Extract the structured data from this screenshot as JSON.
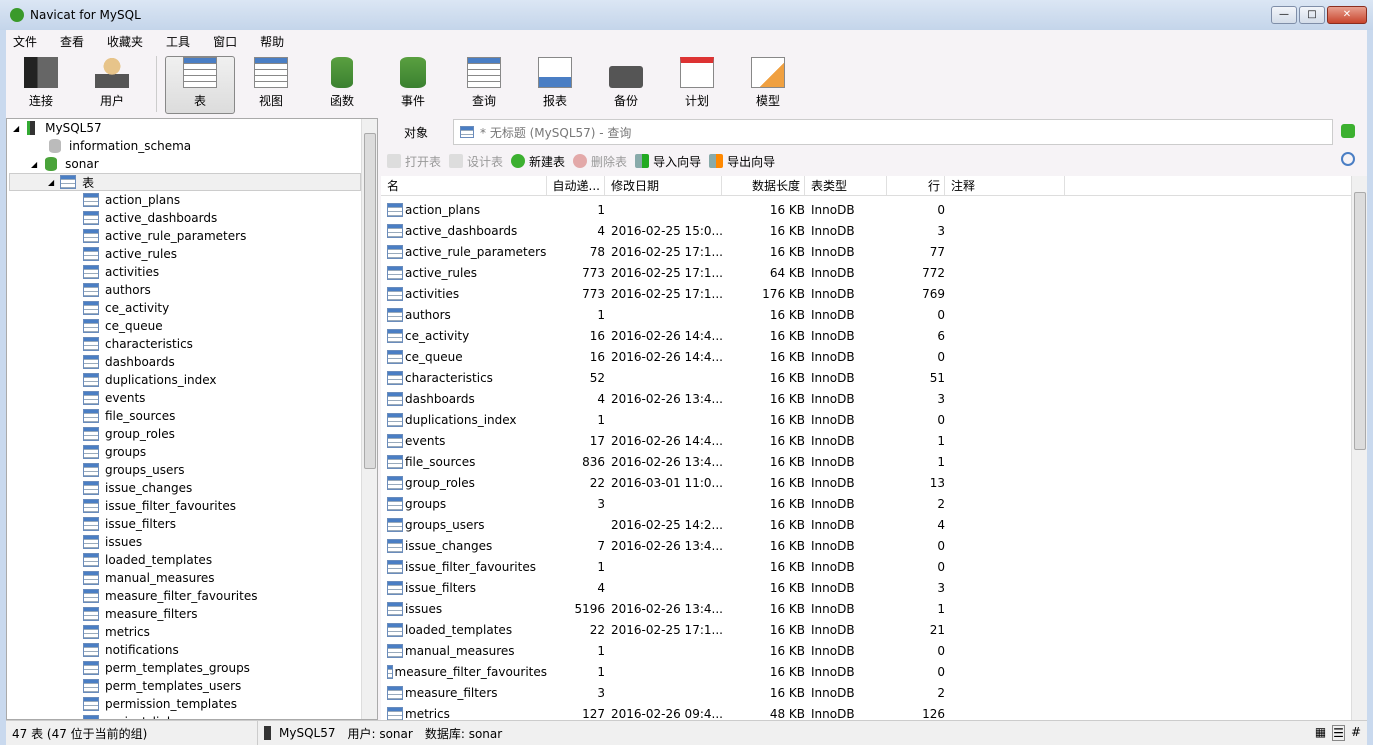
{
  "window": {
    "title": "Navicat for MySQL"
  },
  "menu": [
    "文件",
    "查看",
    "收藏夹",
    "工具",
    "窗口",
    "帮助"
  ],
  "toolbar": [
    {
      "label": "连接",
      "icon": "connection-icon"
    },
    {
      "label": "用户",
      "icon": "user-icon"
    },
    {
      "label": "表",
      "icon": "table-icon",
      "active": true
    },
    {
      "label": "视图",
      "icon": "view-icon"
    },
    {
      "label": "函数",
      "icon": "function-icon"
    },
    {
      "label": "事件",
      "icon": "event-icon"
    },
    {
      "label": "查询",
      "icon": "query-icon"
    },
    {
      "label": "报表",
      "icon": "report-icon"
    },
    {
      "label": "备份",
      "icon": "backup-icon"
    },
    {
      "label": "计划",
      "icon": "schedule-icon"
    },
    {
      "label": "模型",
      "icon": "model-icon"
    }
  ],
  "tree": {
    "connection": "MySQL57",
    "databases": [
      "information_schema",
      "sonar"
    ],
    "group": "表",
    "tables": [
      "action_plans",
      "active_dashboards",
      "active_rule_parameters",
      "active_rules",
      "activities",
      "authors",
      "ce_activity",
      "ce_queue",
      "characteristics",
      "dashboards",
      "duplications_index",
      "events",
      "file_sources",
      "group_roles",
      "groups",
      "groups_users",
      "issue_changes",
      "issue_filter_favourites",
      "issue_filters",
      "issues",
      "loaded_templates",
      "manual_measures",
      "measure_filter_favourites",
      "measure_filters",
      "metrics",
      "notifications",
      "perm_templates_groups",
      "perm_templates_users",
      "permission_templates",
      "project_links"
    ]
  },
  "tabs": {
    "objects": "对象",
    "query_tab": "* 无标题 (MySQL57) - 查询"
  },
  "actions": {
    "open": "打开表",
    "design": "设计表",
    "new": "新建表",
    "delete": "删除表",
    "import": "导入向导",
    "export": "导出向导"
  },
  "columns": [
    "名",
    "自动递...",
    "修改日期",
    "数据长度",
    "表类型",
    "行",
    "注释"
  ],
  "rows": [
    [
      "action_plans",
      "1",
      "",
      "16 KB",
      "InnoDB",
      "0"
    ],
    [
      "active_dashboards",
      "4",
      "2016-02-25 15:0...",
      "16 KB",
      "InnoDB",
      "3"
    ],
    [
      "active_rule_parameters",
      "78",
      "2016-02-25 17:1...",
      "16 KB",
      "InnoDB",
      "77"
    ],
    [
      "active_rules",
      "773",
      "2016-02-25 17:1...",
      "64 KB",
      "InnoDB",
      "772"
    ],
    [
      "activities",
      "773",
      "2016-02-25 17:1...",
      "176 KB",
      "InnoDB",
      "769"
    ],
    [
      "authors",
      "1",
      "",
      "16 KB",
      "InnoDB",
      "0"
    ],
    [
      "ce_activity",
      "16",
      "2016-02-26 14:4...",
      "16 KB",
      "InnoDB",
      "6"
    ],
    [
      "ce_queue",
      "16",
      "2016-02-26 14:4...",
      "16 KB",
      "InnoDB",
      "0"
    ],
    [
      "characteristics",
      "52",
      "",
      "16 KB",
      "InnoDB",
      "51"
    ],
    [
      "dashboards",
      "4",
      "2016-02-26 13:4...",
      "16 KB",
      "InnoDB",
      "3"
    ],
    [
      "duplications_index",
      "1",
      "",
      "16 KB",
      "InnoDB",
      "0"
    ],
    [
      "events",
      "17",
      "2016-02-26 14:4...",
      "16 KB",
      "InnoDB",
      "1"
    ],
    [
      "file_sources",
      "836",
      "2016-02-26 13:4...",
      "16 KB",
      "InnoDB",
      "1"
    ],
    [
      "group_roles",
      "22",
      "2016-03-01 11:0...",
      "16 KB",
      "InnoDB",
      "13"
    ],
    [
      "groups",
      "3",
      "",
      "16 KB",
      "InnoDB",
      "2"
    ],
    [
      "groups_users",
      "",
      "2016-02-25 14:2...",
      "16 KB",
      "InnoDB",
      "4"
    ],
    [
      "issue_changes",
      "7",
      "2016-02-26 13:4...",
      "16 KB",
      "InnoDB",
      "0"
    ],
    [
      "issue_filter_favourites",
      "1",
      "",
      "16 KB",
      "InnoDB",
      "0"
    ],
    [
      "issue_filters",
      "4",
      "",
      "16 KB",
      "InnoDB",
      "3"
    ],
    [
      "issues",
      "5196",
      "2016-02-26 13:4...",
      "16 KB",
      "InnoDB",
      "1"
    ],
    [
      "loaded_templates",
      "22",
      "2016-02-25 17:1...",
      "16 KB",
      "InnoDB",
      "21"
    ],
    [
      "manual_measures",
      "1",
      "",
      "16 KB",
      "InnoDB",
      "0"
    ],
    [
      "measure_filter_favourites",
      "1",
      "",
      "16 KB",
      "InnoDB",
      "0"
    ],
    [
      "measure_filters",
      "3",
      "",
      "16 KB",
      "InnoDB",
      "2"
    ],
    [
      "metrics",
      "127",
      "2016-02-26 09:4...",
      "48 KB",
      "InnoDB",
      "126"
    ]
  ],
  "status": {
    "count": "47 表 (47 位于当前的组)",
    "connection": "MySQL57",
    "user": "用户: sonar",
    "database": "数据库: sonar"
  }
}
